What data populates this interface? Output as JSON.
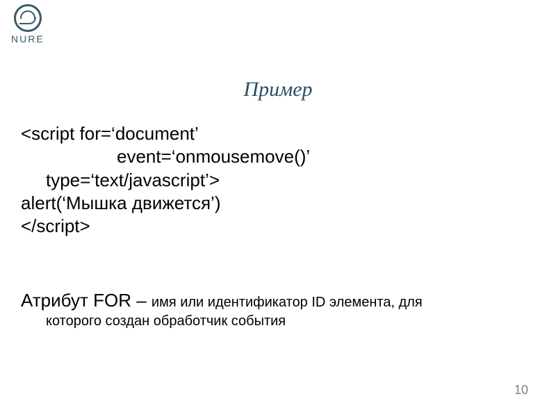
{
  "logo": {
    "text": "NURE"
  },
  "title": "Пример",
  "code": {
    "l1": "<script  for=‘document’",
    "l2": "event=‘onmousemove()’",
    "l3": "type=‘text/javascript’>",
    "l4": "alert(‘Мышка движется’)",
    "l5": "</script>"
  },
  "note": {
    "lead": "Атрибут FOR – ",
    "rest": "имя или идентификатор ID элемента, для",
    "cont": "которого создан обработчик события"
  },
  "page": "10"
}
